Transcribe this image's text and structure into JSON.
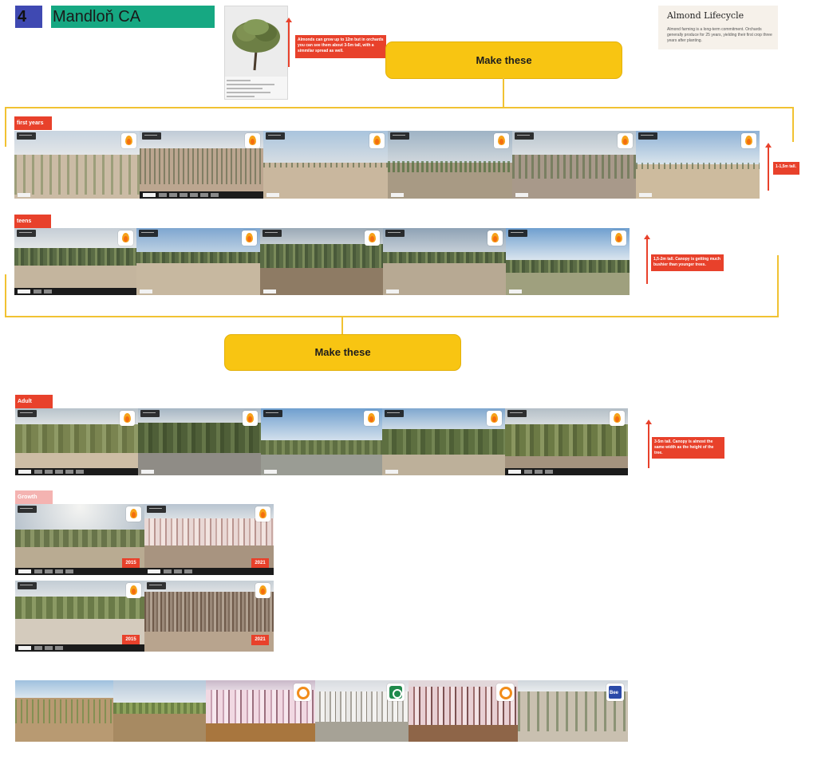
{
  "header": {
    "number": "4",
    "title": "Mandloň CA"
  },
  "tree_card": {
    "icon": "almond-tree-icon"
  },
  "lifecycle_card": {
    "title": "Almond Lifecycle",
    "body": "Almond farming is a long-term commitment. Orchards generally produce for 25 years, yielding their first crop three years after planting."
  },
  "callouts": {
    "tree_height": "Almonds can grow up to 12m but in orchards you can see them about 3-5m tall, with a simmilar spread as well.",
    "first_years": "1-1,5m tall.",
    "teens": "1,5-2m tall. Canopy is getting much bushier than younger trees.",
    "adult": "3-5m tall. Canopy is almost the same width as the height of the tree."
  },
  "buttons": {
    "make_these_top": "Make these",
    "make_these_middle": "Make these"
  },
  "sections": {
    "first_years": "first years",
    "teens": "teens",
    "adult": "Adult",
    "growth": "Growth"
  },
  "growth": {
    "pair1": {
      "left_year": "2015",
      "right_year": "2021"
    },
    "pair2": {
      "left_year": "2015",
      "right_year": "2021"
    }
  },
  "colors": {
    "accent_red": "#e8412b",
    "yellow": "#f8c512",
    "teal": "#16a882",
    "indigo": "#3f49b2"
  }
}
